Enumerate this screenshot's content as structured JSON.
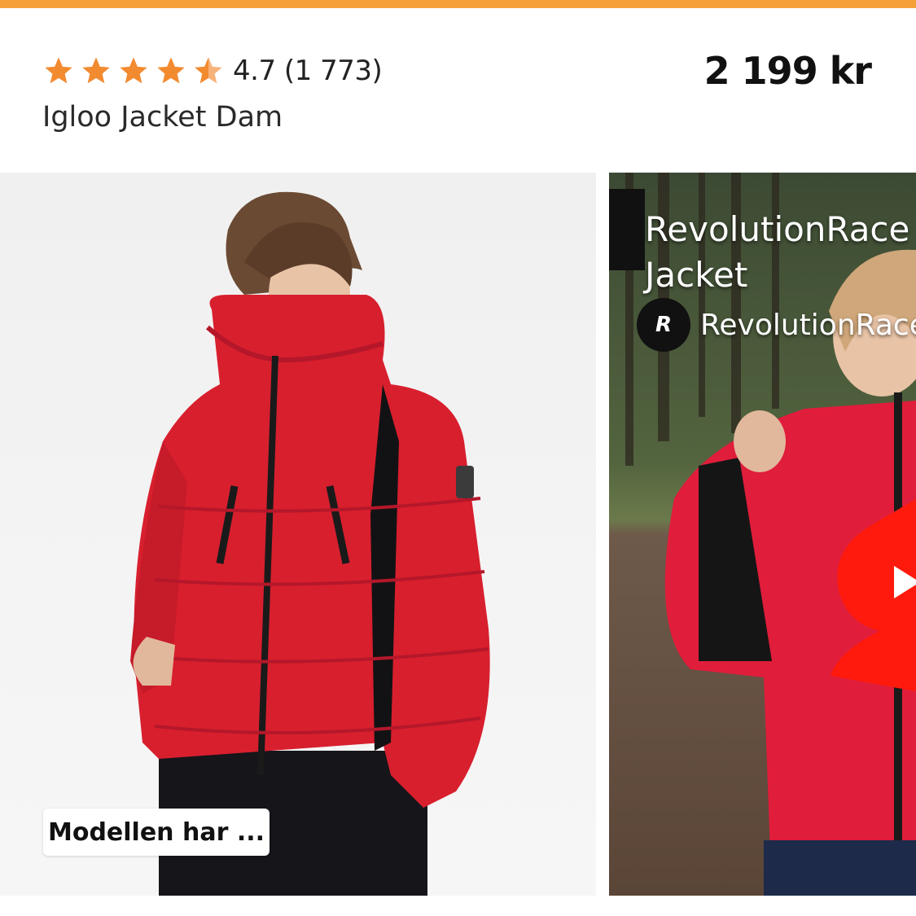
{
  "theme": {
    "accent": "#f5a13a",
    "star": "#f28a30",
    "jacket": "#d81f2e",
    "shorts_red": "#ff1a0d"
  },
  "product": {
    "rating": "4.7",
    "review_count": "(1 773)",
    "rating_text": "4.7 (1 773)",
    "stars": 4.7,
    "name": "Igloo Jacket Dam",
    "price": "2 199 kr"
  },
  "gallery": {
    "photo_chip": "Modellen har ...",
    "video": {
      "title_line1": "RevolutionRace -",
      "title_line2": "Jacket",
      "channel_name": "RevolutionRace",
      "channel_avatar_text": "R",
      "icon": "youtube-shorts-icon"
    }
  }
}
